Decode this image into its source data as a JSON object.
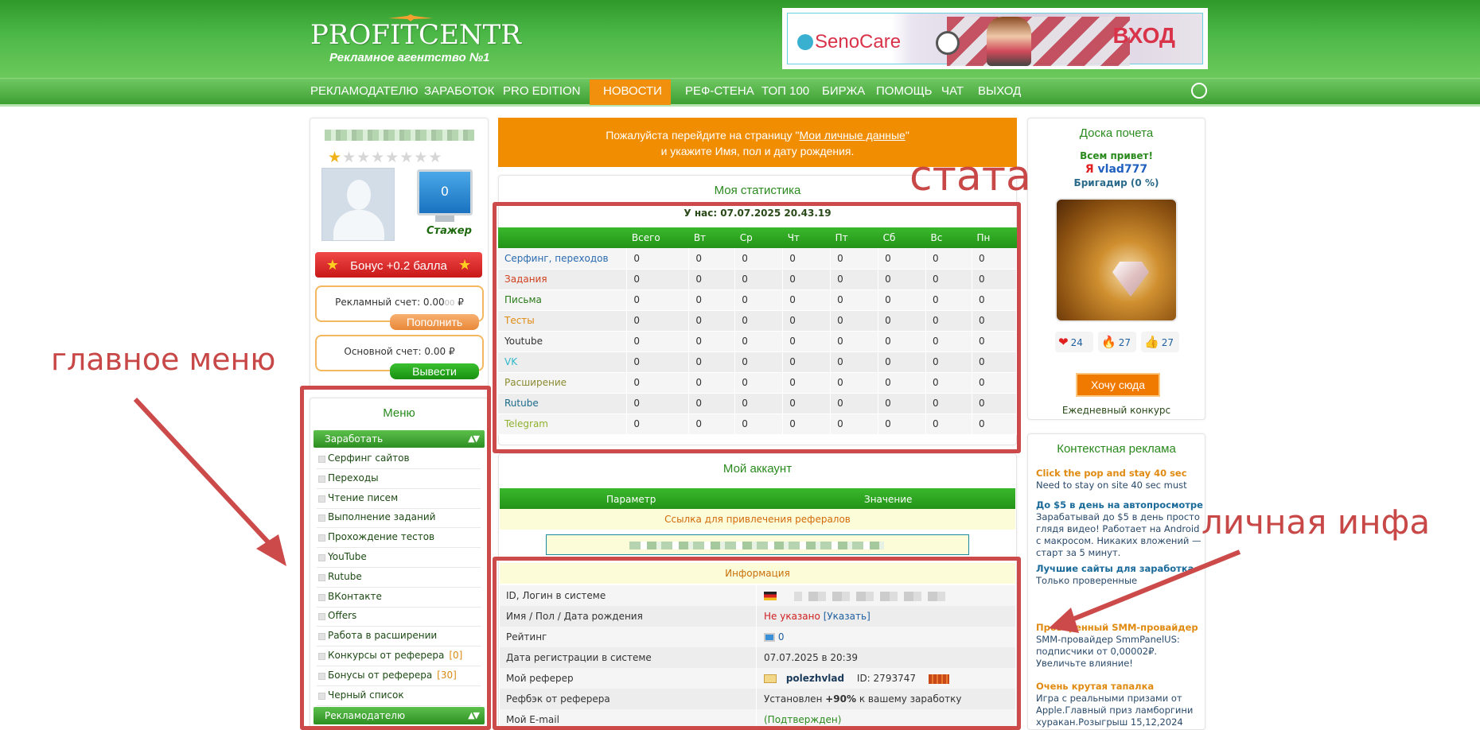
{
  "header": {
    "logo": "PROFITCENTR",
    "logo_sub": "Рекламное агентство №1",
    "banner": {
      "brand": "SenoCare",
      "login": "ВХОД"
    }
  },
  "nav": {
    "items": [
      "РЕКЛАМОДАТЕЛЮ",
      "ЗАРАБОТОК",
      "PRO EDITION",
      "НОВОСТИ",
      "РЕФ-СТЕНА",
      "ТОП 100",
      "БИРЖА",
      "ПОМОЩЬ",
      "ЧАТ",
      "ВЫХОД"
    ],
    "active": "НОВОСТИ"
  },
  "user": {
    "rating_stars": 1,
    "rating_total": 8,
    "monitor_value": "0",
    "rank": "Стажер",
    "bonus": "Бонус +0.2 балла",
    "ad_account": "Рекламный счет: 0.00",
    "ad_account_small": "00",
    "currency": "₽",
    "ad_button": "Пополнить",
    "main_account": "Основной счет: 0.00",
    "main_button": "Вывести"
  },
  "menu": {
    "title": "Меню",
    "sections": [
      {
        "label": "Заработать"
      },
      {
        "label": "Рекламодателю"
      }
    ],
    "items": [
      {
        "label": "Серфинг сайтов"
      },
      {
        "label": "Переходы"
      },
      {
        "label": "Чтение писем"
      },
      {
        "label": "Выполнение заданий"
      },
      {
        "label": "Прохождение тестов"
      },
      {
        "label": "YouTube"
      },
      {
        "label": "Rutube"
      },
      {
        "label": "ВКонтакте"
      },
      {
        "label": "Offers"
      },
      {
        "label": "Работа в расширении"
      },
      {
        "label": "Конкурсы от реферера",
        "count": "[0]"
      },
      {
        "label": "Бонусы от реферера",
        "count": "[30]"
      },
      {
        "label": "Черный список"
      }
    ]
  },
  "notice": {
    "line1_pre": "Пожалуйста перейдите на страницу \"",
    "line1_link": "Мои личные данные",
    "line1_post": "\"",
    "line2": "и укажите Имя, пол и дату рождения."
  },
  "stats": {
    "title": "Моя статистика",
    "date": "У нас: 07.07.2025 20.43.19",
    "columns": [
      "",
      "Всего",
      "Вт",
      "Ср",
      "Чт",
      "Пт",
      "Сб",
      "Вс",
      "Пн"
    ],
    "rows": [
      {
        "label": "Серфинг, переходов",
        "color": "#2a6ab0",
        "values": [
          "0",
          "0",
          "0",
          "0",
          "0",
          "0",
          "0",
          "0"
        ]
      },
      {
        "label": "Задания",
        "color": "#d04020",
        "values": [
          "0",
          "0",
          "0",
          "0",
          "0",
          "0",
          "0",
          "0"
        ]
      },
      {
        "label": "Письма",
        "color": "#2a7a1a",
        "values": [
          "0",
          "0",
          "0",
          "0",
          "0",
          "0",
          "0",
          "0"
        ]
      },
      {
        "label": "Тесты",
        "color": "#e08a10",
        "values": [
          "0",
          "0",
          "0",
          "0",
          "0",
          "0",
          "0",
          "0"
        ]
      },
      {
        "label": "Youtube",
        "color": "#333333",
        "values": [
          "0",
          "0",
          "0",
          "0",
          "0",
          "0",
          "0",
          "0"
        ]
      },
      {
        "label": "VK",
        "color": "#30b8c8",
        "values": [
          "0",
          "0",
          "0",
          "0",
          "0",
          "0",
          "0",
          "0"
        ]
      },
      {
        "label": "Расширение",
        "color": "#8a8a30",
        "values": [
          "0",
          "0",
          "0",
          "0",
          "0",
          "0",
          "0",
          "0"
        ]
      },
      {
        "label": "Rutube",
        "color": "#1a6a8a",
        "values": [
          "0",
          "0",
          "0",
          "0",
          "0",
          "0",
          "0",
          "0"
        ]
      },
      {
        "label": "Telegram",
        "color": "#90b030",
        "values": [
          "0",
          "0",
          "0",
          "0",
          "0",
          "0",
          "0",
          "0"
        ]
      }
    ]
  },
  "account": {
    "title": "Мой аккаунт",
    "col_param": "Параметр",
    "col_value": "Значение",
    "ref_link_label": "Ссылка для привлечения рефералов",
    "info_header": "Информация",
    "rows": {
      "id_key": "ID, Логин в системе",
      "name_key": "Имя / Пол / Дата рождения",
      "name_val": "Не указано",
      "name_link": "[Указать]",
      "rating_key": "Рейтинг",
      "rating_val": "0",
      "reg_key": "Дата регистрации в системе",
      "reg_val": "07.07.2025 в 20:39",
      "referer_key": "Мой реферер",
      "referer_val": "polezhvlad",
      "referer_id": "ID: 2793747",
      "refback_key": "Рефбэк от реферера",
      "refback_pre": "Установлен",
      "refback_pct": "+90%",
      "refback_post": "к вашему заработку",
      "email_key": "Мой E-mail",
      "email_val": "(Подтвержден)"
    }
  },
  "honor": {
    "title": "Доска почета",
    "hello": "Всем привет!",
    "me": "Я",
    "username": "vlad777",
    "rank": "Бригадир (0 %)",
    "reactions": [
      {
        "icon": "❤",
        "count": "24"
      },
      {
        "icon": "🔥",
        "count": "27"
      },
      {
        "icon": "👍",
        "count": "27"
      }
    ],
    "button": "Хочу сюда",
    "daily": "Ежедневный конкурс"
  },
  "ads": {
    "title": "Контекстная реклама",
    "items": [
      {
        "title": "Click the pop and stay 40 sec",
        "text": "Need to stay on site 40 sec must",
        "title_color": "orange"
      },
      {
        "title": "До $5 в день на автопросмотре",
        "text": "Зарабатывай до $5 в день просто глядя видео! Работает на Android с макросом. Никаких вложений — старт за 5 минут.",
        "title_color": "blue"
      },
      {
        "title": "Лучшие сайты для заработка",
        "text": "Только проверенные",
        "title_color": "blue"
      },
      {
        "title": "Проверенный SMM-провайдер",
        "text": "SMM-провайдер SmmPanelUS: подписчики от 0,00002₽. Увеличьте влияние!",
        "title_color": "orange"
      },
      {
        "title": "Очень крутая тапалка",
        "text": "Игра с реальными призами от Apple.Главный приз ламборгини хуракан.Розыгрыш 15,12,2024",
        "title_color": "orange"
      }
    ]
  },
  "annotations": {
    "main_menu": "главное меню",
    "stats": "стата",
    "personal": "личная инфа",
    "color": "#cc4a4a"
  }
}
